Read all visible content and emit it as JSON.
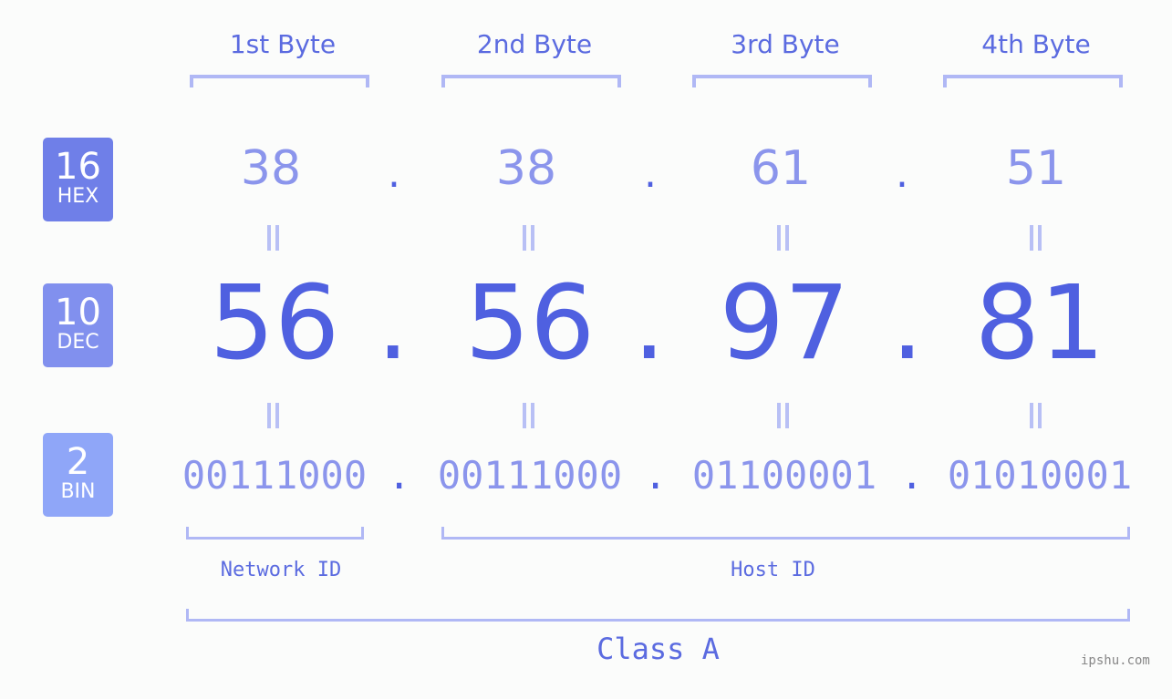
{
  "badges": [
    {
      "num": "16",
      "label": "HEX",
      "color": "#6f7fe8"
    },
    {
      "num": "10",
      "label": "DEC",
      "color": "#8190ee"
    },
    {
      "num": "2",
      "label": "BIN",
      "color": "#8fa6f8"
    }
  ],
  "bytes": [
    {
      "header": "1st Byte",
      "hex": "38",
      "dec": "56",
      "bin": "00111000"
    },
    {
      "header": "2nd Byte",
      "hex": "38",
      "dec": "56",
      "bin": "00111000"
    },
    {
      "header": "3rd Byte",
      "hex": "61",
      "dec": "97",
      "bin": "01100001"
    },
    {
      "header": "4th Byte",
      "hex": "51",
      "dec": "81",
      "bin": "01010001"
    }
  ],
  "separator": ".",
  "network_label": "Network ID",
  "host_label": "Host ID",
  "class_label": "Class A",
  "watermark": "ipshu.com"
}
